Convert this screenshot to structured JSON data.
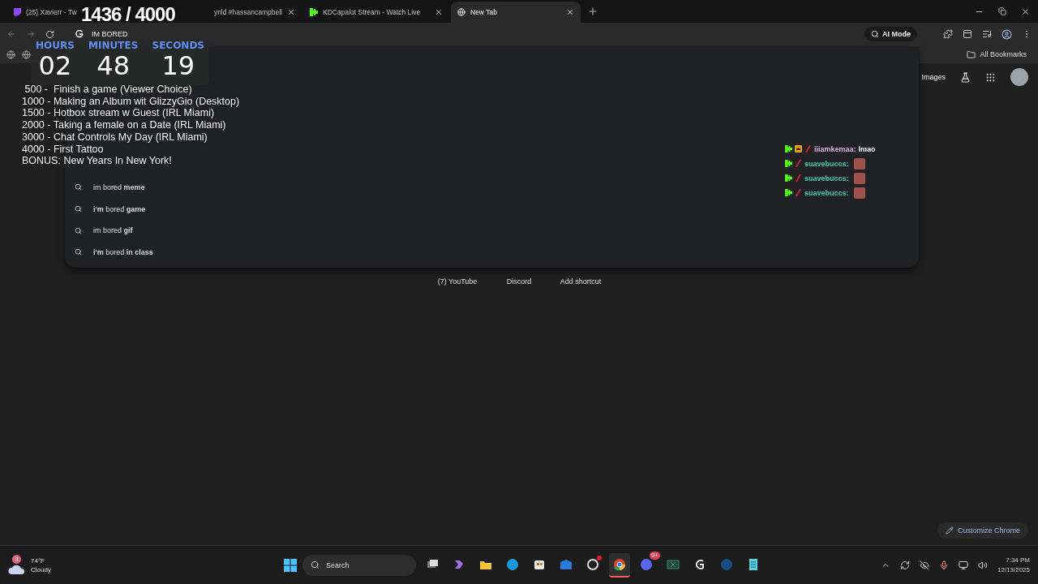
{
  "browser": {
    "tabs": [
      {
        "title": "(25) Xavierr - Tw",
        "kind": "twitch",
        "selected": false
      },
      {
        "title": "ynld #hassancampbell",
        "selected": false
      },
      {
        "title": "KDCapalot Stream - Watch Live",
        "kind": "kick",
        "selected": false
      },
      {
        "title": "New Tab",
        "kind": "chrome",
        "selected": true
      }
    ],
    "address": "IM BORED",
    "ai_mode": "AI Mode",
    "bookmarks_label": "All Bookmarks"
  },
  "suggestions": [
    {
      "text": "im bored **meme**"
    },
    {
      "text": "**i'm** bored **game**"
    },
    {
      "text": "im bored **gif**"
    },
    {
      "text": "**i'm** bored **in class**"
    }
  ],
  "ntp": {
    "links": [
      "Images"
    ],
    "shortcuts": [
      "(7) YouTube",
      "Discord",
      "Add shortcut"
    ],
    "customize": "Customize Chrome"
  },
  "overlay": {
    "counter": "1436 / 4000",
    "timer": [
      {
        "label": "HOURS",
        "value": "02"
      },
      {
        "label": "MINUTES",
        "value": "48"
      },
      {
        "label": "SECONDS",
        "value": "19"
      }
    ],
    "goals": [
      " 500 -  Finish a game (Viewer Choice)",
      "1000 - Making an Album wit GlizzyGio (Desktop)",
      "1500 - Hotbox stream w Guest (IRL Miami)",
      "2000 - Taking a female on a Date (IRL Miami)",
      "3000 - Chat Controls My Day (IRL Miami)",
      "4000 - First Tattoo",
      "BONUS: New Years In New York!"
    ]
  },
  "chat": [
    {
      "user": "iiiamkemaa:",
      "color": "#d9b3e8",
      "badges": [
        {
          "kind": "kick"
        },
        {
          "kind": "crown"
        },
        {
          "kind": "slash"
        }
      ],
      "kind": "text",
      "message": "lmao"
    },
    {
      "user": "suavebuccs:",
      "color": "#3ec9b0",
      "badges": [
        {
          "kind": "kick"
        },
        {
          "kind": "slash"
        }
      ],
      "kind": "emote"
    },
    {
      "user": "suavebuccs:",
      "color": "#3ec9b0",
      "badges": [
        {
          "kind": "kick"
        },
        {
          "kind": "slash"
        }
      ],
      "kind": "emote"
    },
    {
      "user": "suavebuccs:",
      "color": "#3ec9b0",
      "badges": [
        {
          "kind": "kick"
        },
        {
          "kind": "slash"
        }
      ],
      "kind": "emote"
    }
  ],
  "taskbar": {
    "weather": {
      "temp": "74°F",
      "condition": "Cloudy",
      "badge": "3"
    },
    "search": "Search",
    "apps": [
      {
        "kind": "taskview",
        "selected": false,
        "alert": false
      },
      {
        "kind": "copilot",
        "selected": false,
        "alert": false
      },
      {
        "kind": "explorer",
        "selected": false,
        "alert": false
      },
      {
        "kind": "edge",
        "selected": false,
        "alert": false
      },
      {
        "kind": "store",
        "selected": false,
        "alert": false
      },
      {
        "kind": "mail",
        "selected": false,
        "alert": false
      },
      {
        "kind": "obs",
        "selected": false,
        "alert": true
      },
      {
        "kind": "chrome",
        "selected": true,
        "alert": false
      },
      {
        "kind": "discord",
        "selected": false,
        "alert": false,
        "badge": "9+"
      },
      {
        "kind": "xbox",
        "selected": false,
        "alert": false
      },
      {
        "kind": "logitech",
        "selected": false,
        "alert": false
      },
      {
        "kind": "steam",
        "selected": false,
        "alert": false
      },
      {
        "kind": "notepad",
        "selected": false,
        "alert": false
      }
    ],
    "time": "7:34 PM",
    "date": "12/13/2025"
  }
}
